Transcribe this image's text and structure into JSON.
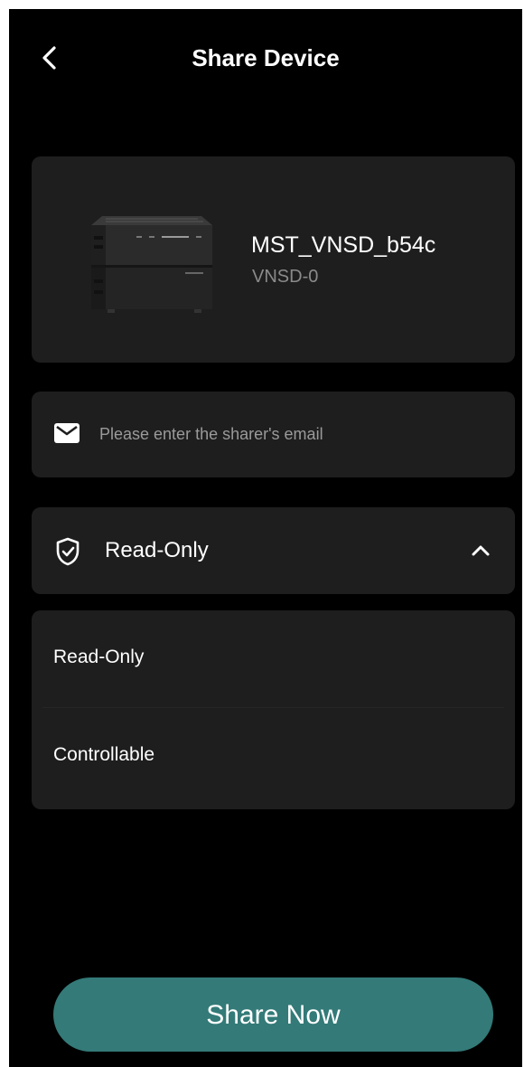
{
  "header": {
    "title": "Share Device",
    "back_icon": "chevron-left-icon"
  },
  "device": {
    "name": "MST_VNSD_b54c",
    "model": "VNSD-0",
    "image": "portable-power-station"
  },
  "email": {
    "icon": "mail-icon",
    "placeholder": "Please enter the sharer's email",
    "value": ""
  },
  "permission": {
    "icon": "shield-check-icon",
    "selected": "Read-Only",
    "expanded": true,
    "options": [
      "Read-Only",
      "Controllable"
    ]
  },
  "share_button": {
    "label": "Share Now"
  },
  "colors": {
    "background": "#000000",
    "card": "#1e1e1e",
    "accent": "#337a78",
    "text_primary": "#ffffff",
    "text_secondary": "#8a8a8a"
  }
}
